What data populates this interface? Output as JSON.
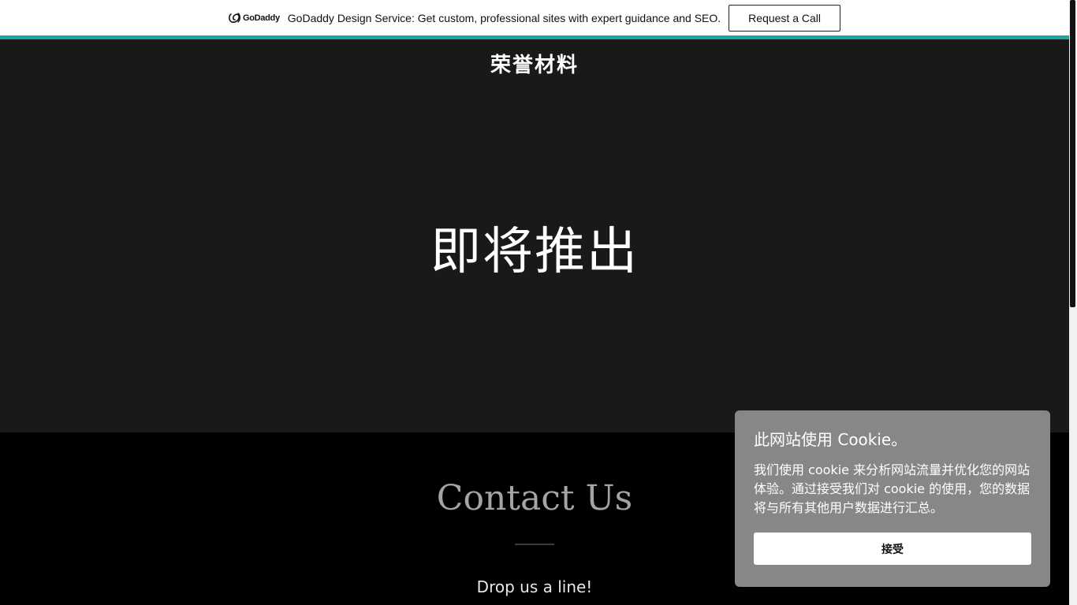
{
  "promo": {
    "logo_text": "GoDaddy",
    "text": "GoDaddy Design Service: Get custom, professional sites with expert guidance and SEO.",
    "button_label": "Request a Call",
    "accent_color": "#1aa5a6"
  },
  "hero": {
    "site_title": "荣誉材料",
    "heading": "即将推出",
    "background": "#191919"
  },
  "contact": {
    "title": "Contact Us",
    "subtitle": "Drop us a line!"
  },
  "cookie": {
    "title": "此网站使用 Cookie。",
    "body": "我们使用 cookie 来分析网站流量并优化您的网站体验。通过接受我们对 cookie 的使用，您的数据将与所有其他用户数据进行汇总。",
    "accept_label": "接受",
    "background": "#878787"
  }
}
